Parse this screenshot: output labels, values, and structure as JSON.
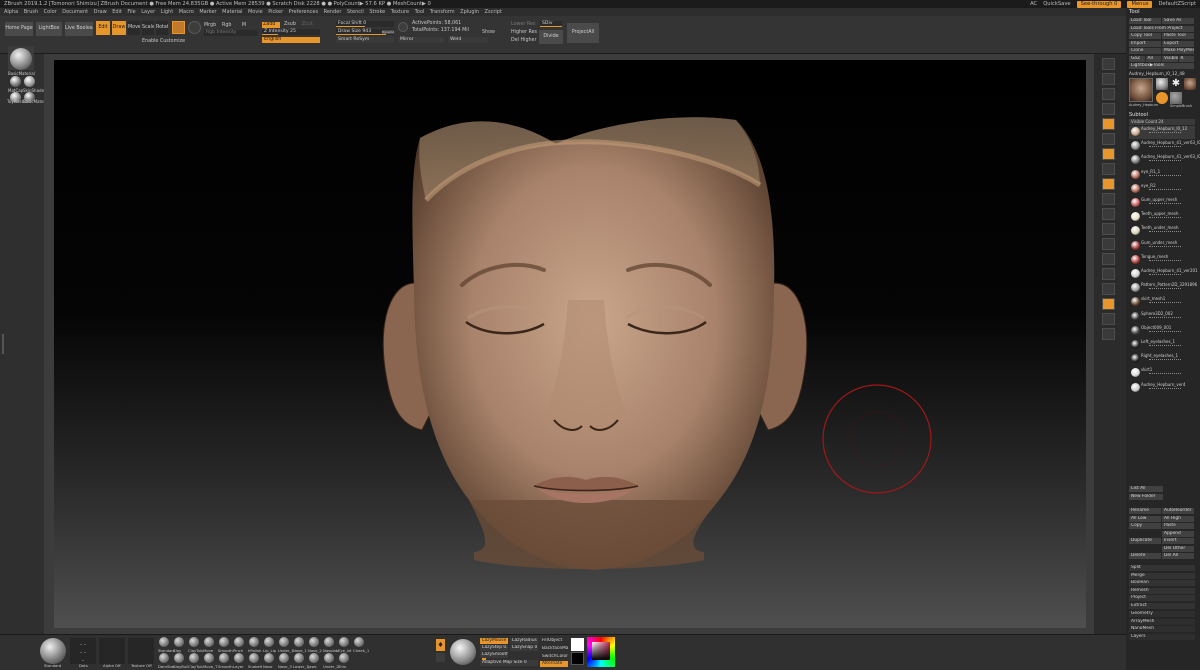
{
  "window": {
    "title": "ZBrush 2019.1.2 [Tomonori Shimizu]   ZBrush Document   ● Free Mem 24.835GB ● Active Mem 28539 ● Scratch Disk 2228 ● ● PolyCount▶ 57.6 KP ● MeshCount▶ 0",
    "right_items": [
      "AC",
      "QuickSave",
      "See-through 0",
      "Menus",
      "DefaultZScript"
    ]
  },
  "menu": [
    "Alpha",
    "Brush",
    "Color",
    "Document",
    "Draw",
    "Edit",
    "File",
    "Layer",
    "Light",
    "Macro",
    "Marker",
    "Material",
    "Movie",
    "Picker",
    "Preferences",
    "Render",
    "Stencil",
    "Stroke",
    "Texture",
    "Tool",
    "Transform",
    "Zplugin",
    "Zscript"
  ],
  "top": {
    "home": "Home Page",
    "lightbox": "LightBox",
    "live_boolean": "Live Boolean",
    "edit": "Edit",
    "draw": "Draw",
    "move": "Move",
    "scale": "Scale",
    "rotate": "Rotate",
    "enable_customize": "Enable Customize",
    "mrgb": "Mrgb",
    "rgb": "Rgb",
    "m": "M",
    "rgb_intensity": "Rgb Intensity",
    "zadd": "Zadd",
    "zsub": "Zsub",
    "zcut": "Zcut",
    "z_intensity": "Z Intensity 25",
    "language": "English",
    "focal_shift": "Focal Shift 0",
    "draw_size": "Draw Size 943",
    "dynamic": "Dynamic",
    "smart_resym": "Smart ReSym",
    "active_points": "ActivePoints: 58,061",
    "total_points": "TotalPoints: 137.194 Mil",
    "mirror": "Mirror",
    "weld": "Weld",
    "show": "Show",
    "lower_res": "Lower Res",
    "higher_res": "Higher Res",
    "sdiv": "SDiv",
    "del_higher": "Del Higher",
    "divide": "Divide",
    "project_all": "ProjectAll"
  },
  "left": {
    "materials": [
      "BasicMaterial",
      "MatCap",
      "SkinShade",
      "ToyPlastic",
      "BasicMaterial2"
    ]
  },
  "tool": {
    "header": "Tool",
    "buttons": [
      [
        "Load Tool",
        "Save As"
      ],
      [
        "Load Tools From Project"
      ],
      [
        "Copy Tool",
        "Paste Tool"
      ],
      [
        "Import",
        "Export"
      ],
      [
        "Clone",
        "Make PolyMesh3D"
      ],
      [
        "GoZ",
        "All",
        "Visible",
        "R"
      ],
      [
        "Lightbox▶Tools"
      ]
    ],
    "current": "Audrey_Hepburn_l0_12_48",
    "thumb_labels": [
      "Audrey_Hepburn",
      "Cylinder3D",
      "SimpleBrush",
      "Audrey_Hepburn"
    ],
    "subtool_header": "Subtool",
    "visible_count": "Visible Count 24",
    "subtools": [
      "Audrey_Hepburn_l0_12",
      "Audrey_Hepburn_41_ver63_l00",
      "Audrey_Hepburn_41_ver63_l00",
      "eye_R1_1",
      "eye_R2",
      "Gum_upper_mesh",
      "Teeth_upper_mesh",
      "Teeth_under_mesh",
      "Gum_under_mesh",
      "Tongue_mesh",
      "Audrey_Hepburn_41_ver201",
      "Pattern_Pattern2D_3291896",
      "skirt_mesh1",
      "Sphere3D2_002",
      "Object009_001",
      "Left_eyelashes_1",
      "Right_eyelashes_1",
      "skirt1",
      "Audrey_Hepburn_ver4"
    ],
    "list_all": "List All",
    "new_folder": "New Folder",
    "ops": [
      [
        "Rename",
        "AutoReorder"
      ],
      [
        "All Low",
        "All High"
      ],
      [
        "Copy",
        "Paste"
      ],
      [
        "",
        "Append"
      ],
      [
        "Duplicate",
        "Insert"
      ],
      [
        "",
        "Del Other"
      ],
      [
        "Delete",
        "Del All"
      ]
    ],
    "menus": [
      "Split",
      "Merge",
      "Boolean",
      "Remesh",
      "Project",
      "Extract"
    ],
    "bottom_menus": [
      "Geometry",
      "ArrayMesh",
      "NanoMesh",
      "Layers"
    ]
  },
  "bottom": {
    "standard": "Standard",
    "dots": "Dots",
    "alpha_off": "Alpha Off",
    "texture_off": "Texture Off",
    "brushes_row1": [
      "Standard",
      "Clay",
      "ClayTub",
      "Move",
      "Smooth",
      "Pinch",
      "hPolish",
      "Lip_Lip",
      "Under_1",
      "Nose_1",
      "Nose_2",
      "Nasolab",
      "Eye_lid",
      "Cheek_1"
    ],
    "brushes_row2": [
      "DamStan",
      "ClayBuil",
      "ClayTub",
      "Move_T",
      "Smooth",
      "Layer",
      "SnakeH",
      "Nose",
      "Nose_3",
      "Lower_1",
      "Jaws",
      "Under_2",
      "Shin"
    ],
    "lazy_mouse": "LazyMouse",
    "lazy_radius": "LazyRadius 1",
    "lazy_step": "LazyStep 0.25",
    "lazy_snap": "LazySnap 0",
    "lazy_smooth": "LazySmooth",
    "adaptive_map_size": "Adaptive Map Size 0",
    "fill_object": "FillObject",
    "backface_mask": "BackfaceMask",
    "switch_color": "SwitchColor",
    "alternate": "Alternate"
  },
  "colors": {
    "accent": "#e8952b",
    "canvas_top": "#000000",
    "canvas_bottom": "#4f4f4f",
    "brush_cursor": "#a01818",
    "skin_light": "#c8a58a",
    "skin_dark": "#5f4532"
  }
}
